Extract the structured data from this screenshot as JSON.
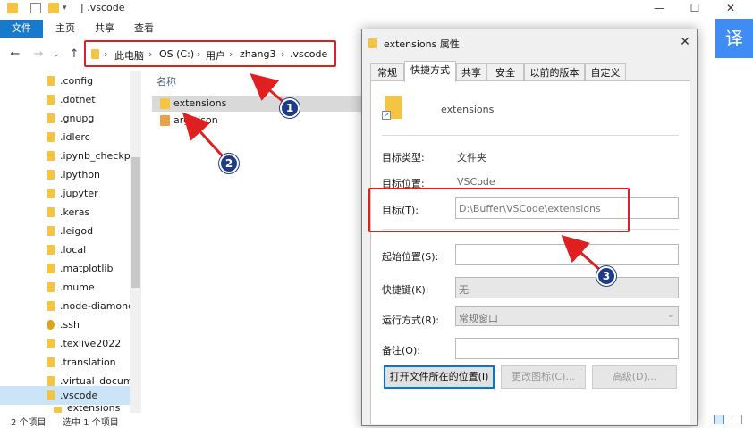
{
  "window": {
    "title": ".vscode"
  },
  "window_controls": {
    "minimize": "—",
    "maximize": "☐",
    "close": "✕"
  },
  "ribbon": {
    "file": "文件",
    "home": "主页",
    "share": "共享",
    "view": "查看"
  },
  "nav_buttons": {
    "back": "←",
    "forward": "→",
    "dropdown": "⌄",
    "up": "↑"
  },
  "address": {
    "this_pc": "此电脑",
    "drive": "OS (C:)",
    "users": "用户",
    "user": "zhang3",
    "folder": ".vscode",
    "separator": "›"
  },
  "navpane": {
    "items": [
      {
        "label": ".config"
      },
      {
        "label": ".dotnet"
      },
      {
        "label": ".gnupg"
      },
      {
        "label": ".idlerc"
      },
      {
        "label": ".ipynb_checkpoints"
      },
      {
        "label": ".ipython"
      },
      {
        "label": ".jupyter"
      },
      {
        "label": ".keras"
      },
      {
        "label": ".leigod"
      },
      {
        "label": ".local"
      },
      {
        "label": ".matplotlib"
      },
      {
        "label": ".mume"
      },
      {
        "label": ".node-diamond"
      },
      {
        "label": ".ssh"
      },
      {
        "label": ".texlive2022"
      },
      {
        "label": ".translation"
      },
      {
        "label": ".virtual_documents"
      },
      {
        "label": ".vscode"
      },
      {
        "label": "extensions"
      }
    ]
  },
  "filepane": {
    "column_name": "名称",
    "files": [
      {
        "label": "extensions"
      },
      {
        "label": "argv.json"
      }
    ]
  },
  "status": {
    "count": "2 个项目",
    "selected": "选中 1 个项目"
  },
  "dialog": {
    "title": "extensions 属性",
    "tabs": [
      "常规",
      "快捷方式",
      "共享",
      "安全",
      "以前的版本",
      "自定义"
    ],
    "name": "extensions",
    "target_type_label": "目标类型:",
    "target_type_value": "文件夹",
    "target_location_label": "目标位置:",
    "target_location_value": "VSCode",
    "target_label": "目标(T):",
    "target_value": "D:\\Buffer\\VSCode\\extensions",
    "start_in_label": "起始位置(S):",
    "start_in_value": "",
    "shortcut_key_label": "快捷键(K):",
    "shortcut_key_value": "无",
    "run_label": "运行方式(R):",
    "run_value": "常规窗口",
    "comment_label": "备注(O):",
    "comment_value": "",
    "open_location_button": "打开文件所在的位置(I)",
    "change_icon_button": "更改图标(C)...",
    "advanced_button": "高级(D)...",
    "close": "✕"
  },
  "annotations": {
    "one": "1",
    "two": "2",
    "three": "3"
  },
  "translate_button": "译",
  "colors": {
    "accent": "#1979ca",
    "highlight": "#e02020",
    "badge": "#1f3c88",
    "folder": "#f4c542"
  }
}
